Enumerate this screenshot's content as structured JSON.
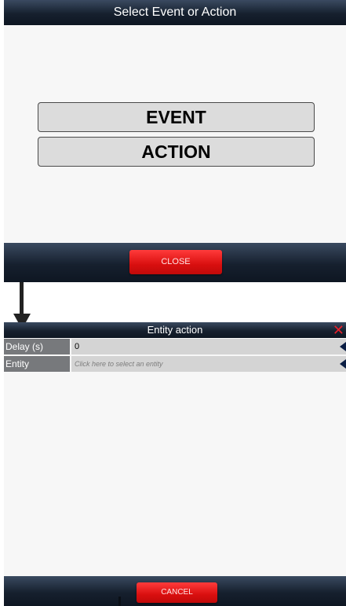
{
  "select_dialog": {
    "title": "Select Event or Action",
    "options": [
      {
        "label": "EVENT"
      },
      {
        "label": "ACTION"
      }
    ],
    "close_label": "CLOSE"
  },
  "action_dialog": {
    "title": "Entity action",
    "close_symbol": "✕",
    "fields": [
      {
        "label": "Delay (s)",
        "value": "0",
        "placeholder": ""
      },
      {
        "label": "Entity",
        "value": "",
        "placeholder": "Click here to select an entity"
      }
    ],
    "cancel_label": "CANCEL"
  },
  "colors": {
    "header_bar": "#16202e",
    "primary_red": "#d90f0f",
    "option_fill": "#dcdcdc",
    "field_label_bg": "#77797c",
    "field_value_bg": "#d4d4d4",
    "close_x": "#e8202a"
  },
  "icons": {
    "flow_arrow": "down-arrow-icon",
    "dropdown": "dropdown-triangle-icon",
    "close": "close-icon"
  }
}
